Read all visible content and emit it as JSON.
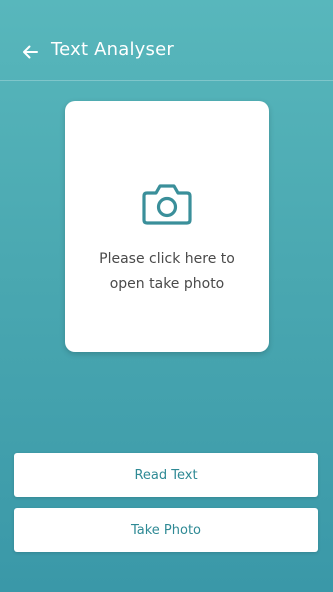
{
  "app_bar": {
    "title": "Text Analyser",
    "back_icon": "arrow-left-icon"
  },
  "photo_card": {
    "icon": "camera-icon",
    "line1": "Please click here to",
    "line2": "open take photo"
  },
  "actions": {
    "read_text_label": "Read Text",
    "take_photo_label": "Take Photo"
  },
  "colors": {
    "background_top": "#58b7bc",
    "background_bottom": "#3a98a8",
    "accent": "#2f8a95",
    "surface": "#ffffff"
  }
}
